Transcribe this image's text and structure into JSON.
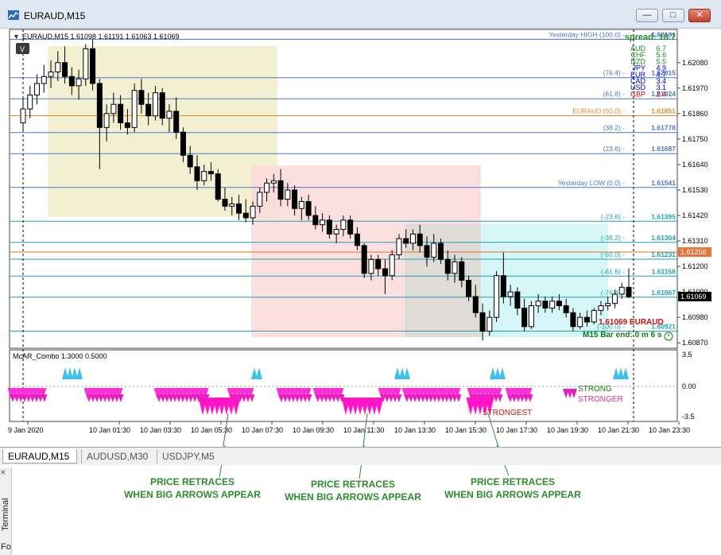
{
  "window": {
    "title": "EURAUD,M15",
    "controls": [
      "minimize",
      "restore",
      "close"
    ]
  },
  "chart_header": "EURAUD,M15  1.61098 1.61191 1.61063 1.61069",
  "mode_button": "V",
  "price_axis": [
    "1.62080",
    "1.61970",
    "1.61860",
    "1.61750",
    "1.61640",
    "1.61530",
    "1.61420",
    "1.61310",
    "1.61200",
    "1.61090",
    "1.60980",
    "1.60870"
  ],
  "current_price": "1.61069",
  "marker_price": "1.61256",
  "spread_label": "spread: 18.7",
  "currency_strength": [
    {
      "ccy": "AUD",
      "val": "6.7",
      "color": "#228b22"
    },
    {
      "ccy": "CHF",
      "val": "5.6",
      "color": "#228b22"
    },
    {
      "ccy": "NZD",
      "val": "5.5",
      "color": "#228b22"
    },
    {
      "ccy": "JPY",
      "val": "4.9",
      "color": "#0000cc"
    },
    {
      "ccy": "EUR",
      "val": "4.7",
      "color": "#0000cc"
    },
    {
      "ccy": "CAD",
      "val": "3.4",
      "color": "#0000cc"
    },
    {
      "ccy": "USD",
      "val": "3.1",
      "color": "#0000cc"
    },
    {
      "ccy": "GBP",
      "val": "2.4",
      "color": "#cc0000"
    }
  ],
  "levels": [
    {
      "label": "Yesterday HIGH (100.0) -",
      "price": "1.62181",
      "color": "#4a76c9"
    },
    {
      "label": "(76.4) -",
      "price": "1.62015",
      "color": "#4a76c9"
    },
    {
      "label": "(61.8) -",
      "price": "1.61924",
      "color": "#4a76c9"
    },
    {
      "label": "EURAUD (50.0) -",
      "price": "1.61851",
      "color": "#e08a2c"
    },
    {
      "label": "(38.2) -",
      "price": "1.61778",
      "color": "#4a76c9"
    },
    {
      "label": "(23.6) -",
      "price": "1.61687",
      "color": "#4a76c9"
    },
    {
      "label": "Yesterday LOW (0.0) -",
      "price": "1.61541",
      "color": "#4a76c9"
    },
    {
      "label": "(-23.6) -",
      "price": "1.61395",
      "color": "#1fa0b0"
    },
    {
      "label": "(-38.2) -",
      "price": "1.61304",
      "color": "#1fa0b0"
    },
    {
      "label": "(-50.0) -",
      "price": "1.61231",
      "color": "#1fa0b0"
    },
    {
      "label": "(-61.8) -",
      "price": "1.61158",
      "color": "#1fa0b0"
    },
    {
      "label": "(-76.4) -",
      "price": "1.61067",
      "color": "#1fa0b0"
    },
    {
      "label": "(-100.0) -",
      "price": "1.60921",
      "color": "#1fa0b0"
    }
  ],
  "price_badge": "1.61069 EURAUD",
  "bar_end": "M15 Bar end: 0 m 6 s",
  "indicator": {
    "name": "McAR_Combo 1.3000 0.5000",
    "axis": [
      "3.5",
      "0.00",
      "-3.5"
    ],
    "strong": "STRONG",
    "stronger": "STRONGER",
    "strongest": "STRONGEST"
  },
  "time_axis": [
    "9 Jan 2020",
    "10 Jan 01:30",
    "10 Jan 03:30",
    "10 Jan 05:30",
    "10 Jan 07:30",
    "10 Jan 09:30",
    "10 Jan 11:30",
    "10 Jan 13:30",
    "10 Jan 15:30",
    "10 Jan 17:30",
    "10 Jan 19:30",
    "10 Jan 21:30",
    "10 Jan 23:30"
  ],
  "tabs": [
    "EURAUD,M15",
    "AUDUSD,M30",
    "USDJPY,M5"
  ],
  "sidebar": {
    "terminal": "Terminal",
    "fo": "Fo"
  },
  "annotations": [
    {
      "line1": "PRICE RETRACES",
      "line2": "WHEN BIG ARROWS APPEAR"
    },
    {
      "line1": "PRICE RETRACES",
      "line2": "WHEN BIG ARROWS APPEAR"
    },
    {
      "line1": "PRICE RETRACES",
      "line2": "WHEN BIG ARROWS APPEAR"
    }
  ],
  "chart_data": {
    "type": "candlestick",
    "ylim": [
      1.6085,
      1.6222
    ],
    "candles": [
      [
        1.6182,
        1.6193,
        1.6178,
        1.6188
      ],
      [
        1.6188,
        1.6198,
        1.6184,
        1.6194
      ],
      [
        1.6194,
        1.6203,
        1.619,
        1.6199
      ],
      [
        1.6199,
        1.6207,
        1.6195,
        1.6202
      ],
      [
        1.6202,
        1.6209,
        1.6197,
        1.6204
      ],
      [
        1.6204,
        1.6213,
        1.62,
        1.6208
      ],
      [
        1.6208,
        1.6215,
        1.6199,
        1.6202
      ],
      [
        1.6202,
        1.6206,
        1.6194,
        1.6198
      ],
      [
        1.6198,
        1.6205,
        1.6192,
        1.6201
      ],
      [
        1.6201,
        1.6216,
        1.6198,
        1.6214
      ],
      [
        1.6214,
        1.6218,
        1.6196,
        1.6199
      ],
      [
        1.6199,
        1.6201,
        1.6162,
        1.618
      ],
      [
        1.618,
        1.619,
        1.6174,
        1.6186
      ],
      [
        1.6186,
        1.6195,
        1.6182,
        1.619
      ],
      [
        1.619,
        1.6194,
        1.6179,
        1.6182
      ],
      [
        1.6182,
        1.6188,
        1.6177,
        1.618
      ],
      [
        1.618,
        1.6199,
        1.6178,
        1.6196
      ],
      [
        1.6196,
        1.6201,
        1.6186,
        1.619
      ],
      [
        1.619,
        1.6195,
        1.6181,
        1.6185
      ],
      [
        1.6185,
        1.6198,
        1.6183,
        1.6195
      ],
      [
        1.6195,
        1.6197,
        1.6181,
        1.6184
      ],
      [
        1.6184,
        1.619,
        1.6178,
        1.6187
      ],
      [
        1.6187,
        1.6193,
        1.6175,
        1.6178
      ],
      [
        1.6178,
        1.618,
        1.6165,
        1.6168
      ],
      [
        1.6168,
        1.6172,
        1.616,
        1.6163
      ],
      [
        1.6163,
        1.6168,
        1.6153,
        1.6157
      ],
      [
        1.6157,
        1.6164,
        1.6155,
        1.6161
      ],
      [
        1.6161,
        1.6165,
        1.6157,
        1.616
      ],
      [
        1.616,
        1.6162,
        1.6148,
        1.6149
      ],
      [
        1.6149,
        1.6154,
        1.6144,
        1.6146
      ],
      [
        1.6146,
        1.615,
        1.6142,
        1.6147
      ],
      [
        1.6147,
        1.6151,
        1.614,
        1.6143
      ],
      [
        1.6143,
        1.6149,
        1.6139,
        1.6141
      ],
      [
        1.6141,
        1.6148,
        1.6138,
        1.6146
      ],
      [
        1.6146,
        1.6154,
        1.6143,
        1.6152
      ],
      [
        1.6152,
        1.6158,
        1.6148,
        1.6156
      ],
      [
        1.6156,
        1.616,
        1.6152,
        1.6157
      ],
      [
        1.6157,
        1.6162,
        1.6146,
        1.6149
      ],
      [
        1.6149,
        1.6156,
        1.6146,
        1.6153
      ],
      [
        1.6153,
        1.6155,
        1.6142,
        1.6145
      ],
      [
        1.6145,
        1.615,
        1.614,
        1.6148
      ],
      [
        1.6148,
        1.6151,
        1.614,
        1.6142
      ],
      [
        1.6142,
        1.6146,
        1.6136,
        1.6138
      ],
      [
        1.6138,
        1.6143,
        1.6135,
        1.614
      ],
      [
        1.614,
        1.6142,
        1.6132,
        1.6134
      ],
      [
        1.6134,
        1.6138,
        1.613,
        1.6136
      ],
      [
        1.6136,
        1.6142,
        1.6133,
        1.614
      ],
      [
        1.614,
        1.6142,
        1.6132,
        1.6134
      ],
      [
        1.6134,
        1.6137,
        1.6127,
        1.6129
      ],
      [
        1.6129,
        1.613,
        1.6115,
        1.6117
      ],
      [
        1.6117,
        1.6125,
        1.6114,
        1.6123
      ],
      [
        1.6123,
        1.6125,
        1.6116,
        1.6119
      ],
      [
        1.6119,
        1.6123,
        1.6108,
        1.6116
      ],
      [
        1.6116,
        1.6127,
        1.6114,
        1.6125
      ],
      [
        1.6125,
        1.6134,
        1.6123,
        1.6132
      ],
      [
        1.6132,
        1.6136,
        1.6128,
        1.613
      ],
      [
        1.613,
        1.6136,
        1.6127,
        1.6134
      ],
      [
        1.6134,
        1.6138,
        1.6126,
        1.6129
      ],
      [
        1.6129,
        1.6133,
        1.612,
        1.6124
      ],
      [
        1.6124,
        1.6134,
        1.6122,
        1.613
      ],
      [
        1.613,
        1.6132,
        1.6121,
        1.6123
      ],
      [
        1.6123,
        1.6127,
        1.6114,
        1.6117
      ],
      [
        1.6117,
        1.6125,
        1.6113,
        1.6122
      ],
      [
        1.6122,
        1.6124,
        1.6111,
        1.6114
      ],
      [
        1.6114,
        1.6116,
        1.6105,
        1.6107
      ],
      [
        1.6107,
        1.6112,
        1.6098,
        1.61
      ],
      [
        1.61,
        1.6104,
        1.6088,
        1.6092
      ],
      [
        1.6092,
        1.6101,
        1.609,
        1.6098
      ],
      [
        1.6098,
        1.6118,
        1.6096,
        1.6116
      ],
      [
        1.6116,
        1.6126,
        1.6104,
        1.6107
      ],
      [
        1.6107,
        1.6112,
        1.6103,
        1.6109
      ],
      [
        1.6109,
        1.6111,
        1.6099,
        1.6102
      ],
      [
        1.6102,
        1.6106,
        1.6092,
        1.6094
      ],
      [
        1.6094,
        1.6105,
        1.6093,
        1.6103
      ],
      [
        1.6103,
        1.6108,
        1.61,
        1.6105
      ],
      [
        1.6105,
        1.6107,
        1.61,
        1.6102
      ],
      [
        1.6102,
        1.6107,
        1.61,
        1.6105
      ],
      [
        1.6105,
        1.6108,
        1.6101,
        1.6103
      ],
      [
        1.6103,
        1.6106,
        1.6098,
        1.61
      ],
      [
        1.61,
        1.6102,
        1.6092,
        1.6094
      ],
      [
        1.6094,
        1.61,
        1.6093,
        1.6098
      ],
      [
        1.6098,
        1.6101,
        1.6094,
        1.6096
      ],
      [
        1.6096,
        1.6102,
        1.6095,
        1.6101
      ],
      [
        1.6101,
        1.6105,
        1.6099,
        1.6103
      ],
      [
        1.6103,
        1.6107,
        1.6101,
        1.6104
      ],
      [
        1.6104,
        1.611,
        1.6102,
        1.6108
      ],
      [
        1.6108,
        1.6113,
        1.6106,
        1.6111
      ],
      [
        1.6111,
        1.61191,
        1.61063,
        1.61069
      ]
    ],
    "big_arrow_zones": [
      "10 Jan 06:00-07:30",
      "10 Jan 12:00-13:30",
      "10 Jan 16:00-17:30"
    ]
  }
}
